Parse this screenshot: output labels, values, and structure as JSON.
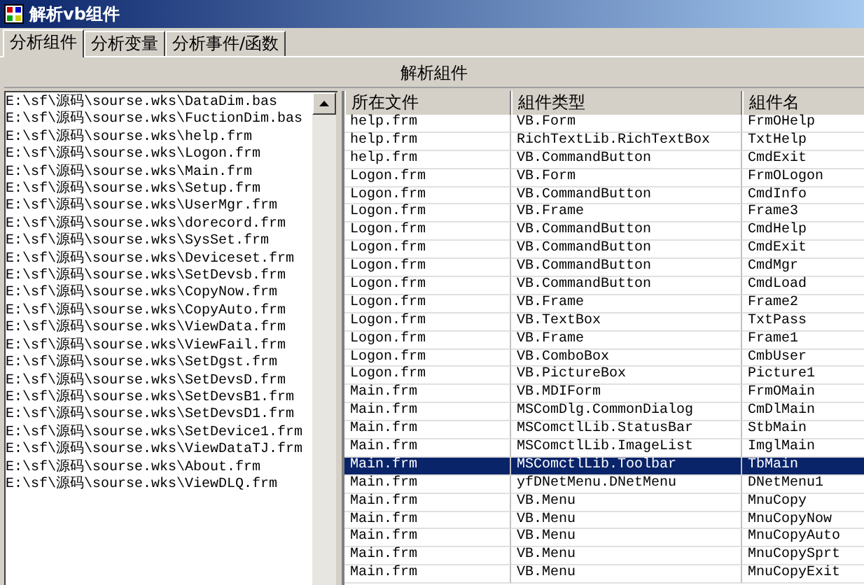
{
  "window": {
    "title": "解析vb组件"
  },
  "tabs": [
    {
      "label": "分析组件",
      "selected": true
    },
    {
      "label": "分析变量",
      "selected": false
    },
    {
      "label": "分析事件/函数",
      "selected": false
    }
  ],
  "panel_title": "解析組件",
  "file_list": [
    "E:\\sf\\源码\\sourse.wks\\DataDim.bas",
    "E:\\sf\\源码\\sourse.wks\\FuctionDim.bas",
    "E:\\sf\\源码\\sourse.wks\\help.frm",
    "E:\\sf\\源码\\sourse.wks\\Logon.frm",
    "E:\\sf\\源码\\sourse.wks\\Main.frm",
    "E:\\sf\\源码\\sourse.wks\\Setup.frm",
    "E:\\sf\\源码\\sourse.wks\\UserMgr.frm",
    "E:\\sf\\源码\\sourse.wks\\dorecord.frm",
    "E:\\sf\\源码\\sourse.wks\\SysSet.frm",
    "E:\\sf\\源码\\sourse.wks\\Deviceset.frm",
    "E:\\sf\\源码\\sourse.wks\\SetDevsb.frm",
    "E:\\sf\\源码\\sourse.wks\\CopyNow.frm",
    "E:\\sf\\源码\\sourse.wks\\CopyAuto.frm",
    "E:\\sf\\源码\\sourse.wks\\ViewData.frm",
    "E:\\sf\\源码\\sourse.wks\\ViewFail.frm",
    "E:\\sf\\源码\\sourse.wks\\SetDgst.frm",
    "E:\\sf\\源码\\sourse.wks\\SetDevsD.frm",
    "E:\\sf\\源码\\sourse.wks\\SetDevsB1.frm",
    "E:\\sf\\源码\\sourse.wks\\SetDevsD1.frm",
    "E:\\sf\\源码\\sourse.wks\\SetDevice1.frm",
    "E:\\sf\\源码\\sourse.wks\\ViewDataTJ.frm",
    "E:\\sf\\源码\\sourse.wks\\About.frm",
    "E:\\sf\\源码\\sourse.wks\\ViewDLQ.frm"
  ],
  "table": {
    "columns": [
      "所在文件",
      "組件类型",
      "組件名"
    ],
    "rows": [
      {
        "cells": [
          "help.frm",
          "VB.Form",
          "FrmOHelp"
        ],
        "selected": false
      },
      {
        "cells": [
          "help.frm",
          "RichTextLib.RichTextBox",
          "TxtHelp"
        ],
        "selected": false
      },
      {
        "cells": [
          "help.frm",
          "VB.CommandButton",
          "CmdExit"
        ],
        "selected": false
      },
      {
        "cells": [
          "Logon.frm",
          "VB.Form",
          "FrmOLogon"
        ],
        "selected": false
      },
      {
        "cells": [
          "Logon.frm",
          "VB.CommandButton",
          "CmdInfo"
        ],
        "selected": false
      },
      {
        "cells": [
          "Logon.frm",
          "VB.Frame",
          "Frame3"
        ],
        "selected": false
      },
      {
        "cells": [
          "Logon.frm",
          "VB.CommandButton",
          "CmdHelp"
        ],
        "selected": false
      },
      {
        "cells": [
          "Logon.frm",
          "VB.CommandButton",
          "CmdExit"
        ],
        "selected": false
      },
      {
        "cells": [
          "Logon.frm",
          "VB.CommandButton",
          "CmdMgr"
        ],
        "selected": false
      },
      {
        "cells": [
          "Logon.frm",
          "VB.CommandButton",
          "CmdLoad"
        ],
        "selected": false
      },
      {
        "cells": [
          "Logon.frm",
          "VB.Frame",
          "Frame2"
        ],
        "selected": false
      },
      {
        "cells": [
          "Logon.frm",
          "VB.TextBox",
          "TxtPass"
        ],
        "selected": false
      },
      {
        "cells": [
          "Logon.frm",
          "VB.Frame",
          "Frame1"
        ],
        "selected": false
      },
      {
        "cells": [
          "Logon.frm",
          "VB.ComboBox",
          "CmbUser"
        ],
        "selected": false
      },
      {
        "cells": [
          "Logon.frm",
          "VB.PictureBox",
          "Picture1"
        ],
        "selected": false
      },
      {
        "cells": [
          "Main.frm",
          "VB.MDIForm",
          "FrmOMain"
        ],
        "selected": false
      },
      {
        "cells": [
          "Main.frm",
          "MSComDlg.CommonDialog",
          "CmDlMain"
        ],
        "selected": false
      },
      {
        "cells": [
          "Main.frm",
          "MSComctlLib.StatusBar",
          "StbMain"
        ],
        "selected": false
      },
      {
        "cells": [
          "Main.frm",
          "MSComctlLib.ImageList",
          "ImglMain"
        ],
        "selected": false
      },
      {
        "cells": [
          "Main.frm",
          "MSComctlLib.Toolbar",
          "TbMain"
        ],
        "selected": true
      },
      {
        "cells": [
          "Main.frm",
          "yfDNetMenu.DNetMenu",
          "DNetMenu1"
        ],
        "selected": false
      },
      {
        "cells": [
          "Main.frm",
          "VB.Menu",
          "MnuCopy"
        ],
        "selected": false
      },
      {
        "cells": [
          "Main.frm",
          "VB.Menu",
          "MnuCopyNow"
        ],
        "selected": false
      },
      {
        "cells": [
          "Main.frm",
          "VB.Menu",
          "MnuCopyAuto"
        ],
        "selected": false
      },
      {
        "cells": [
          "Main.frm",
          "VB.Menu",
          "MnuCopySprt"
        ],
        "selected": false
      },
      {
        "cells": [
          "Main.frm",
          "VB.Menu",
          "MnuCopyExit"
        ],
        "selected": false
      }
    ]
  }
}
